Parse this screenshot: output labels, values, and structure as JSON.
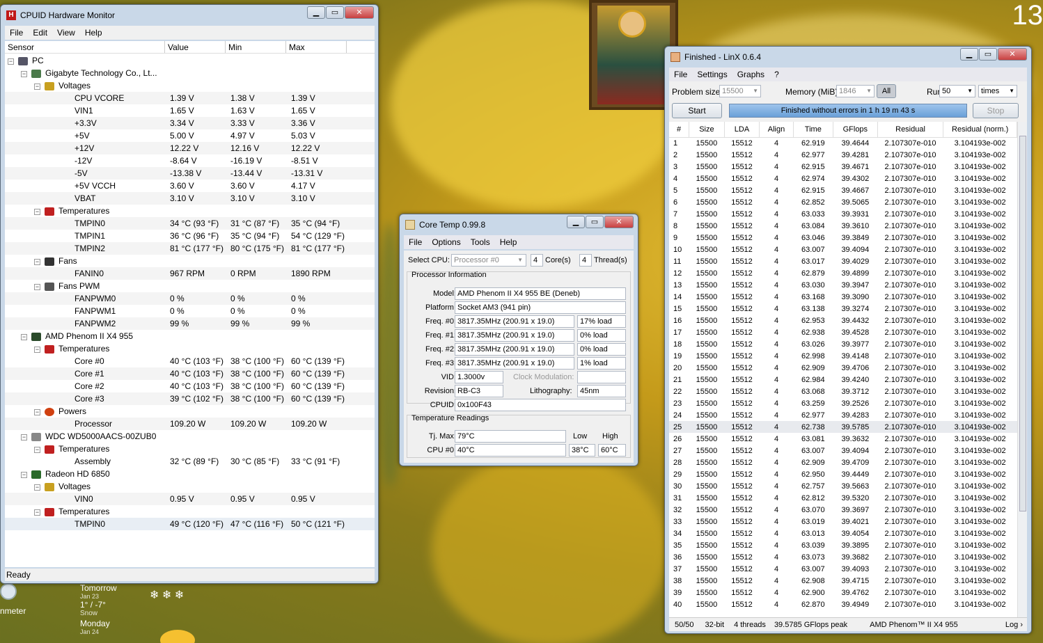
{
  "desktop": {
    "clock_partial": "13",
    "weather": [
      {
        "day": "Tomorrow",
        "date": "Jan 23",
        "temp": "1° / -7°",
        "cond": "Snow"
      },
      {
        "day": "Monday",
        "date": "Jan 24"
      }
    ],
    "gadget_label": "nmeter"
  },
  "hwmon": {
    "title": "CPUID Hardware Monitor",
    "menu": [
      "File",
      "Edit",
      "View",
      "Help"
    ],
    "columns": [
      "Sensor",
      "Value",
      "Min",
      "Max"
    ],
    "status": "Ready",
    "rows": [
      {
        "lvl": 0,
        "kind": "node",
        "icon": "pc-icon",
        "name": "PC"
      },
      {
        "lvl": 1,
        "kind": "node",
        "icon": "motherboard-icon",
        "name": "Gigabyte Technology Co., Lt..."
      },
      {
        "lvl": 2,
        "kind": "node",
        "icon": "voltage-icon",
        "name": "Voltages"
      },
      {
        "lvl": 3,
        "name": "CPU VCORE",
        "v": "1.39 V",
        "min": "1.38 V",
        "max": "1.39 V"
      },
      {
        "lvl": 3,
        "name": "VIN1",
        "v": "1.65 V",
        "min": "1.63 V",
        "max": "1.65 V"
      },
      {
        "lvl": 3,
        "name": "+3.3V",
        "v": "3.34 V",
        "min": "3.33 V",
        "max": "3.36 V"
      },
      {
        "lvl": 3,
        "name": "+5V",
        "v": "5.00 V",
        "min": "4.97 V",
        "max": "5.03 V"
      },
      {
        "lvl": 3,
        "name": "+12V",
        "v": "12.22 V",
        "min": "12.16 V",
        "max": "12.22 V"
      },
      {
        "lvl": 3,
        "name": "-12V",
        "v": "-8.64 V",
        "min": "-16.19 V",
        "max": "-8.51 V"
      },
      {
        "lvl": 3,
        "name": "-5V",
        "v": "-13.38 V",
        "min": "-13.44 V",
        "max": "-13.31 V"
      },
      {
        "lvl": 3,
        "name": "+5V VCCH",
        "v": "3.60 V",
        "min": "3.60 V",
        "max": "4.17 V"
      },
      {
        "lvl": 3,
        "name": "VBAT",
        "v": "3.10 V",
        "min": "3.10 V",
        "max": "3.10 V"
      },
      {
        "lvl": 2,
        "kind": "node",
        "icon": "thermometer-icon",
        "name": "Temperatures"
      },
      {
        "lvl": 3,
        "name": "TMPIN0",
        "v": "34 °C  (93 °F)",
        "min": "31 °C  (87 °F)",
        "max": "35 °C  (94 °F)"
      },
      {
        "lvl": 3,
        "name": "TMPIN1",
        "v": "36 °C  (96 °F)",
        "min": "35 °C  (94 °F)",
        "max": "54 °C  (129 °F)"
      },
      {
        "lvl": 3,
        "name": "TMPIN2",
        "v": "81 °C  (177 °F)",
        "min": "80 °C  (175 °F)",
        "max": "81 °C  (177 °F)"
      },
      {
        "lvl": 2,
        "kind": "node",
        "icon": "fan-icon",
        "name": "Fans"
      },
      {
        "lvl": 3,
        "name": "FANIN0",
        "v": "967 RPM",
        "min": "0 RPM",
        "max": "1890 RPM"
      },
      {
        "lvl": 2,
        "kind": "node",
        "icon": "fan-pwm-icon",
        "name": "Fans PWM"
      },
      {
        "lvl": 3,
        "name": "FANPWM0",
        "v": "0 %",
        "min": "0 %",
        "max": "0 %"
      },
      {
        "lvl": 3,
        "name": "FANPWM1",
        "v": "0 %",
        "min": "0 %",
        "max": "0 %"
      },
      {
        "lvl": 3,
        "name": "FANPWM2",
        "v": "99 %",
        "min": "99 %",
        "max": "99 %"
      },
      {
        "lvl": 1,
        "kind": "node",
        "icon": "cpu-icon",
        "name": "AMD Phenom II X4 955"
      },
      {
        "lvl": 2,
        "kind": "node",
        "icon": "thermometer-icon",
        "name": "Temperatures"
      },
      {
        "lvl": 3,
        "name": "Core #0",
        "v": "40 °C  (103 °F)",
        "min": "38 °C  (100 °F)",
        "max": "60 °C  (139 °F)"
      },
      {
        "lvl": 3,
        "name": "Core #1",
        "v": "40 °C  (103 °F)",
        "min": "38 °C  (100 °F)",
        "max": "60 °C  (139 °F)"
      },
      {
        "lvl": 3,
        "name": "Core #2",
        "v": "40 °C  (103 °F)",
        "min": "38 °C  (100 °F)",
        "max": "60 °C  (139 °F)"
      },
      {
        "lvl": 3,
        "name": "Core #3",
        "v": "39 °C  (102 °F)",
        "min": "38 °C  (100 °F)",
        "max": "60 °C  (139 °F)"
      },
      {
        "lvl": 2,
        "kind": "node",
        "icon": "power-icon",
        "name": "Powers"
      },
      {
        "lvl": 3,
        "name": "Processor",
        "v": "109.20 W",
        "min": "109.20 W",
        "max": "109.20 W"
      },
      {
        "lvl": 1,
        "kind": "node",
        "icon": "hdd-icon",
        "name": "WDC WD5000AACS-00ZUB0"
      },
      {
        "lvl": 2,
        "kind": "node",
        "icon": "thermometer-icon",
        "name": "Temperatures"
      },
      {
        "lvl": 3,
        "name": "Assembly",
        "v": "32 °C  (89 °F)",
        "min": "30 °C  (85 °F)",
        "max": "33 °C  (91 °F)"
      },
      {
        "lvl": 1,
        "kind": "node",
        "icon": "gpu-icon",
        "name": "Radeon HD 6850"
      },
      {
        "lvl": 2,
        "kind": "node",
        "icon": "voltage-icon",
        "name": "Voltages"
      },
      {
        "lvl": 3,
        "name": "VIN0",
        "v": "0.95 V",
        "min": "0.95 V",
        "max": "0.95 V"
      },
      {
        "lvl": 2,
        "kind": "node",
        "icon": "thermometer-icon",
        "name": "Temperatures"
      },
      {
        "lvl": 3,
        "name": "TMPIN0",
        "v": "49 °C  (120 °F)",
        "min": "47 °C  (116 °F)",
        "max": "50 °C  (121 °F)",
        "sel": true
      }
    ]
  },
  "coretemp": {
    "title": "Core Temp 0.99.8",
    "menu": [
      "File",
      "Options",
      "Tools",
      "Help"
    ],
    "select_cpu_label": "Select CPU:",
    "select_cpu_value": "Processor #0",
    "cores": "4",
    "cores_label": "Core(s)",
    "threads": "4",
    "threads_label": "Thread(s)",
    "proc_info_label": "Processor Information",
    "model_label": "Model:",
    "model": "AMD Phenom II X4 955 BE (Deneb)",
    "platform_label": "Platform:",
    "platform": "Socket AM3 (941 pin)",
    "freqs": [
      {
        "label": "Freq. #0:",
        "val": "3817.35MHz (200.91 x 19.0)",
        "load": "17% load"
      },
      {
        "label": "Freq. #1:",
        "val": "3817.35MHz (200.91 x 19.0)",
        "load": "0% load"
      },
      {
        "label": "Freq. #2:",
        "val": "3817.35MHz (200.91 x 19.0)",
        "load": "0% load"
      },
      {
        "label": "Freq. #3:",
        "val": "3817.35MHz (200.91 x 19.0)",
        "load": "1% load"
      }
    ],
    "vid_label": "VID:",
    "vid": "1.3000v",
    "clockmod_label": "Clock Modulation:",
    "revision_label": "Revision:",
    "revision": "RB-C3",
    "litho_label": "Lithography:",
    "litho": "45nm",
    "cpuid_label": "CPUID:",
    "cpuid": "0x100F43",
    "temp_label": "Temperature Readings",
    "tjmax_label": "Tj. Max:",
    "tjmax": "79°C",
    "low_label": "Low",
    "high_label": "High",
    "cpu0_label": "CPU #0:",
    "cpu0": "40°C",
    "cpu0_low": "38°C",
    "cpu0_high": "60°C"
  },
  "linx": {
    "title": "Finished - LinX 0.6.4",
    "menu": [
      "File",
      "Settings",
      "Graphs",
      "?"
    ],
    "problem_label": "Problem size:",
    "problem": "15500",
    "memory_label": "Memory (MiB):",
    "memory": "1846",
    "all_label": "All",
    "run_label": "Run:",
    "run": "50",
    "times": "times",
    "start": "Start",
    "status": "Finished without errors in 1 h 19 m 43 s",
    "stop": "Stop",
    "columns": [
      "#",
      "Size",
      "LDA",
      "Align",
      "Time",
      "GFlops",
      "Residual",
      "Residual (norm.)"
    ],
    "rows": [
      [
        "1",
        "15500",
        "15512",
        "4",
        "62.919",
        "39.4644",
        "2.107307e-010",
        "3.104193e-002"
      ],
      [
        "2",
        "15500",
        "15512",
        "4",
        "62.977",
        "39.4281",
        "2.107307e-010",
        "3.104193e-002"
      ],
      [
        "3",
        "15500",
        "15512",
        "4",
        "62.915",
        "39.4671",
        "2.107307e-010",
        "3.104193e-002"
      ],
      [
        "4",
        "15500",
        "15512",
        "4",
        "62.974",
        "39.4302",
        "2.107307e-010",
        "3.104193e-002"
      ],
      [
        "5",
        "15500",
        "15512",
        "4",
        "62.915",
        "39.4667",
        "2.107307e-010",
        "3.104193e-002"
      ],
      [
        "6",
        "15500",
        "15512",
        "4",
        "62.852",
        "39.5065",
        "2.107307e-010",
        "3.104193e-002"
      ],
      [
        "7",
        "15500",
        "15512",
        "4",
        "63.033",
        "39.3931",
        "2.107307e-010",
        "3.104193e-002"
      ],
      [
        "8",
        "15500",
        "15512",
        "4",
        "63.084",
        "39.3610",
        "2.107307e-010",
        "3.104193e-002"
      ],
      [
        "9",
        "15500",
        "15512",
        "4",
        "63.046",
        "39.3849",
        "2.107307e-010",
        "3.104193e-002"
      ],
      [
        "10",
        "15500",
        "15512",
        "4",
        "63.007",
        "39.4094",
        "2.107307e-010",
        "3.104193e-002"
      ],
      [
        "11",
        "15500",
        "15512",
        "4",
        "63.017",
        "39.4029",
        "2.107307e-010",
        "3.104193e-002"
      ],
      [
        "12",
        "15500",
        "15512",
        "4",
        "62.879",
        "39.4899",
        "2.107307e-010",
        "3.104193e-002"
      ],
      [
        "13",
        "15500",
        "15512",
        "4",
        "63.030",
        "39.3947",
        "2.107307e-010",
        "3.104193e-002"
      ],
      [
        "14",
        "15500",
        "15512",
        "4",
        "63.168",
        "39.3090",
        "2.107307e-010",
        "3.104193e-002"
      ],
      [
        "15",
        "15500",
        "15512",
        "4",
        "63.138",
        "39.3274",
        "2.107307e-010",
        "3.104193e-002"
      ],
      [
        "16",
        "15500",
        "15512",
        "4",
        "62.953",
        "39.4432",
        "2.107307e-010",
        "3.104193e-002"
      ],
      [
        "17",
        "15500",
        "15512",
        "4",
        "62.938",
        "39.4528",
        "2.107307e-010",
        "3.104193e-002"
      ],
      [
        "18",
        "15500",
        "15512",
        "4",
        "63.026",
        "39.3977",
        "2.107307e-010",
        "3.104193e-002"
      ],
      [
        "19",
        "15500",
        "15512",
        "4",
        "62.998",
        "39.4148",
        "2.107307e-010",
        "3.104193e-002"
      ],
      [
        "20",
        "15500",
        "15512",
        "4",
        "62.909",
        "39.4706",
        "2.107307e-010",
        "3.104193e-002"
      ],
      [
        "21",
        "15500",
        "15512",
        "4",
        "62.984",
        "39.4240",
        "2.107307e-010",
        "3.104193e-002"
      ],
      [
        "22",
        "15500",
        "15512",
        "4",
        "63.068",
        "39.3712",
        "2.107307e-010",
        "3.104193e-002"
      ],
      [
        "23",
        "15500",
        "15512",
        "4",
        "63.259",
        "39.2526",
        "2.107307e-010",
        "3.104193e-002"
      ],
      [
        "24",
        "15500",
        "15512",
        "4",
        "62.977",
        "39.4283",
        "2.107307e-010",
        "3.104193e-002"
      ],
      [
        "25",
        "15500",
        "15512",
        "4",
        "62.738",
        "39.5785",
        "2.107307e-010",
        "3.104193e-002"
      ],
      [
        "26",
        "15500",
        "15512",
        "4",
        "63.081",
        "39.3632",
        "2.107307e-010",
        "3.104193e-002"
      ],
      [
        "27",
        "15500",
        "15512",
        "4",
        "63.007",
        "39.4094",
        "2.107307e-010",
        "3.104193e-002"
      ],
      [
        "28",
        "15500",
        "15512",
        "4",
        "62.909",
        "39.4709",
        "2.107307e-010",
        "3.104193e-002"
      ],
      [
        "29",
        "15500",
        "15512",
        "4",
        "62.950",
        "39.4449",
        "2.107307e-010",
        "3.104193e-002"
      ],
      [
        "30",
        "15500",
        "15512",
        "4",
        "62.757",
        "39.5663",
        "2.107307e-010",
        "3.104193e-002"
      ],
      [
        "31",
        "15500",
        "15512",
        "4",
        "62.812",
        "39.5320",
        "2.107307e-010",
        "3.104193e-002"
      ],
      [
        "32",
        "15500",
        "15512",
        "4",
        "63.070",
        "39.3697",
        "2.107307e-010",
        "3.104193e-002"
      ],
      [
        "33",
        "15500",
        "15512",
        "4",
        "63.019",
        "39.4021",
        "2.107307e-010",
        "3.104193e-002"
      ],
      [
        "34",
        "15500",
        "15512",
        "4",
        "63.013",
        "39.4054",
        "2.107307e-010",
        "3.104193e-002"
      ],
      [
        "35",
        "15500",
        "15512",
        "4",
        "63.039",
        "39.3895",
        "2.107307e-010",
        "3.104193e-002"
      ],
      [
        "36",
        "15500",
        "15512",
        "4",
        "63.073",
        "39.3682",
        "2.107307e-010",
        "3.104193e-002"
      ],
      [
        "37",
        "15500",
        "15512",
        "4",
        "63.007",
        "39.4093",
        "2.107307e-010",
        "3.104193e-002"
      ],
      [
        "38",
        "15500",
        "15512",
        "4",
        "62.908",
        "39.4715",
        "2.107307e-010",
        "3.104193e-002"
      ],
      [
        "39",
        "15500",
        "15512",
        "4",
        "62.900",
        "39.4762",
        "2.107307e-010",
        "3.104193e-002"
      ],
      [
        "40",
        "15500",
        "15512",
        "4",
        "62.870",
        "39.4949",
        "2.107307e-010",
        "3.104193e-002"
      ]
    ],
    "highlight_row": 25,
    "statusbar": [
      "50/50",
      "32-bit",
      "4 threads",
      "39.5785 GFlops peak",
      "AMD Phenom™ II X4 955",
      "Log ›"
    ]
  }
}
